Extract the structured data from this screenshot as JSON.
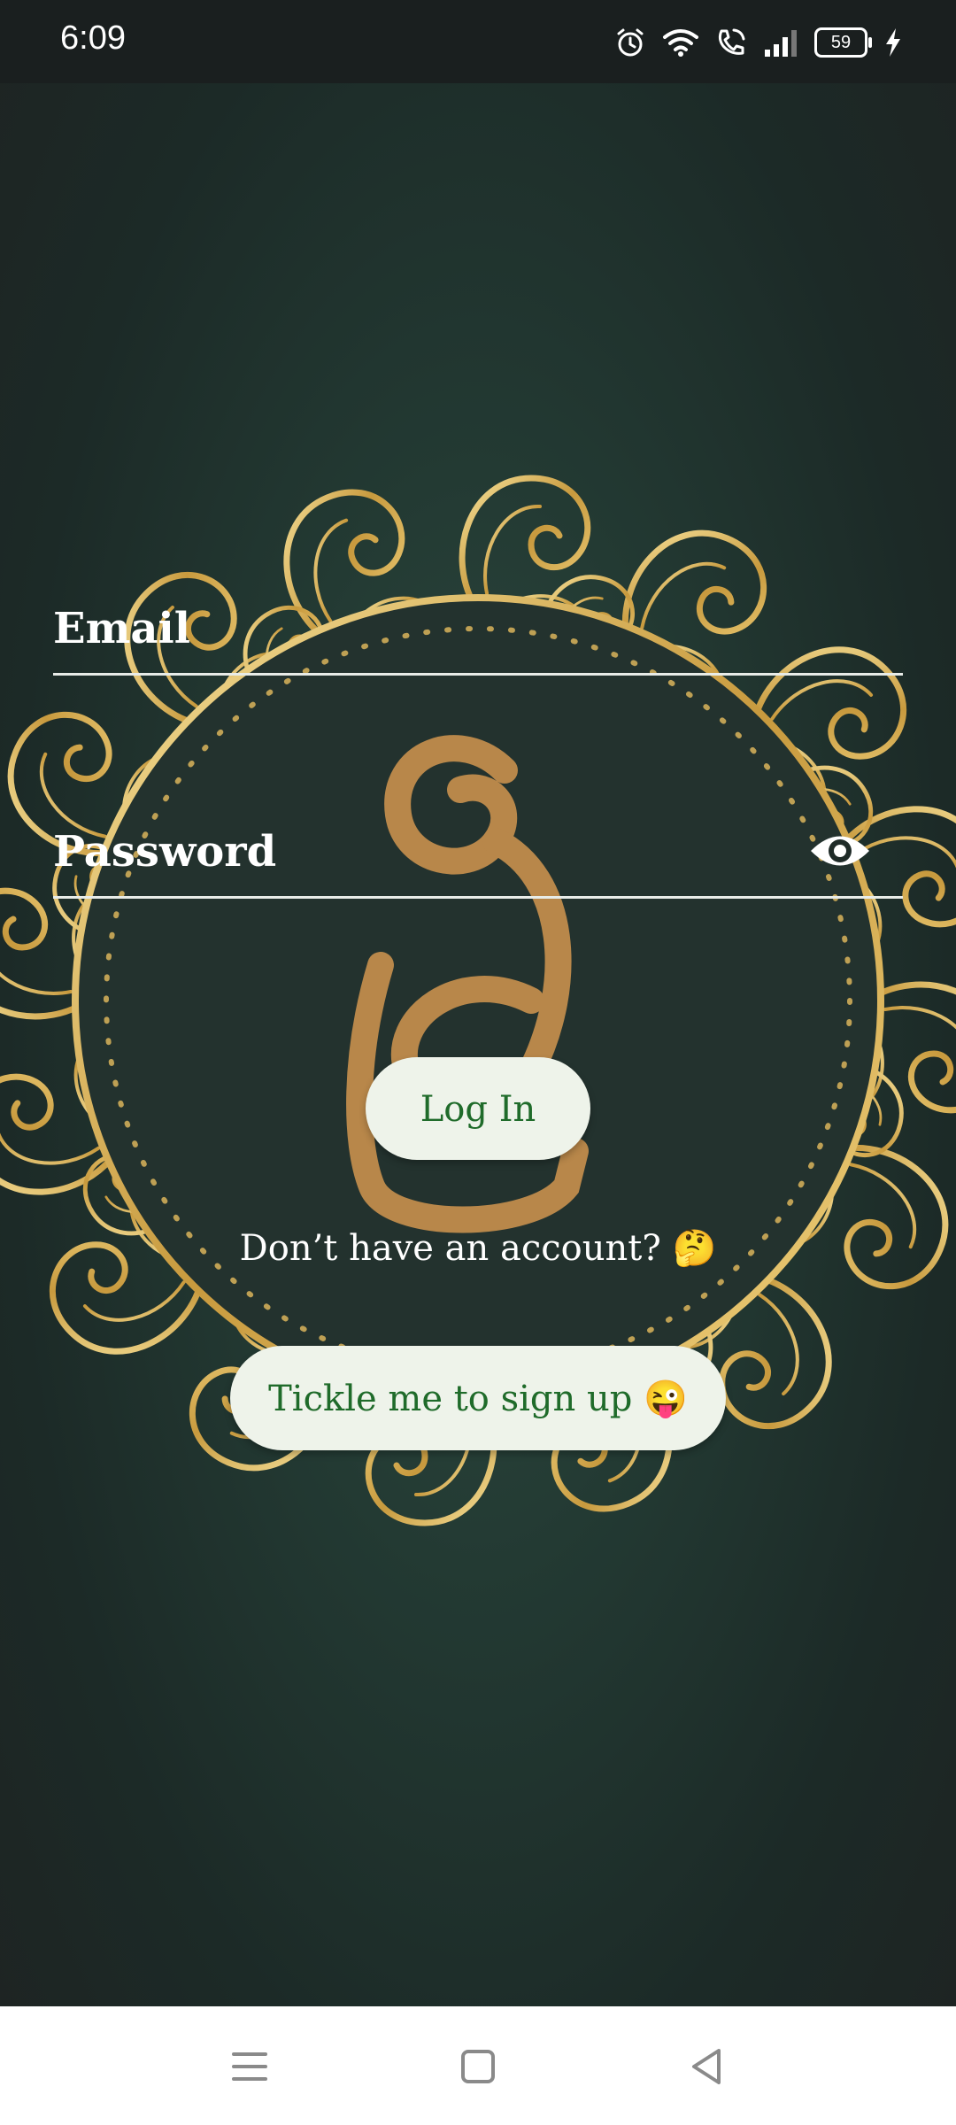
{
  "status_bar": {
    "time": "6:09",
    "battery_level": "59",
    "icons": [
      "alarm-icon",
      "wifi-icon",
      "wifi-calling-icon",
      "signal-icon",
      "battery-icon",
      "charging-icon"
    ]
  },
  "login_form": {
    "email_placeholder": "Email",
    "password_placeholder": "Password",
    "password_toggle_icon": "eye-icon",
    "login_label": "Log In",
    "no_account_text": "Don’t have an account? 🤔",
    "signup_label": "Tickle me to sign up 😜"
  },
  "background": {
    "logo_icon": "sinhala-letter-logo-icon"
  },
  "nav_bar": {
    "icons": [
      "menu-icon",
      "home-icon",
      "back-icon"
    ]
  },
  "colors": {
    "button_bg": "#eef3ea",
    "button_text": "#1f6b2a",
    "gold": "#d9b45a",
    "logo": "#b8874a"
  }
}
